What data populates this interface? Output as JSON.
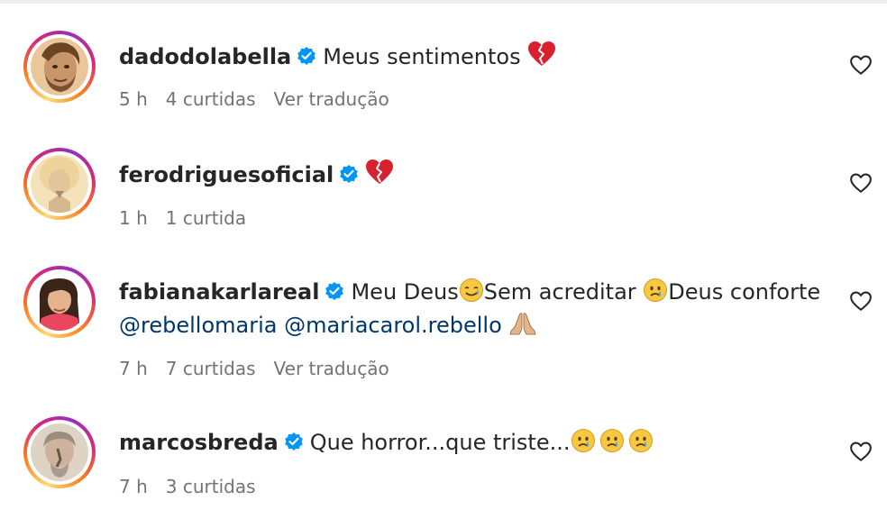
{
  "comments": [
    {
      "username": "dadodolabella",
      "text": "Meus sentimentos",
      "emoji": "broken-heart-icon",
      "time": "5 h",
      "likes": "4 curtidas",
      "translate": "Ver tradução"
    },
    {
      "username": "ferodriguesoficial",
      "text": "",
      "emoji": "broken-heart-icon",
      "time": "1 h",
      "likes": "1 curtida"
    },
    {
      "username": "fabianakarlareal",
      "text_part1": "Meu Deus",
      "text_part2": "Sem acreditar",
      "text_part3": "Deus conforte",
      "mention1": "@rebellomaria",
      "mention2": "@mariacarol.rebello",
      "time": "7 h",
      "likes": "7 curtidas",
      "translate": "Ver tradução"
    },
    {
      "username": "marcosbreda",
      "text": "Que horror...que triste...",
      "time": "7 h",
      "likes": "3 curtidas"
    }
  ],
  "colors": {
    "verified": "#0095f6",
    "mention": "#00376b",
    "meta": "#737373",
    "heart_emoji": "#d8202f"
  }
}
